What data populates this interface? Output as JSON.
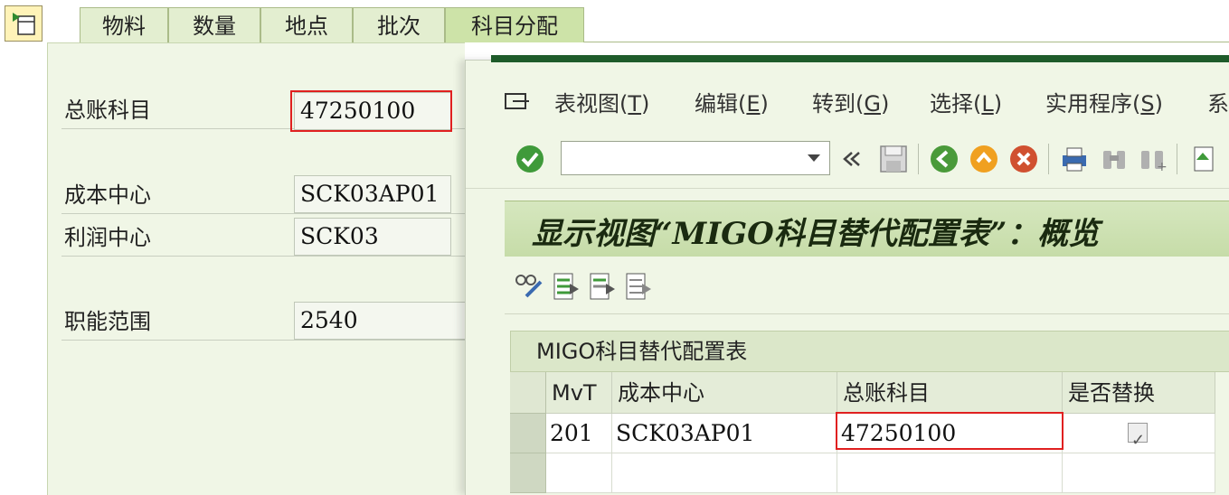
{
  "tabs": [
    {
      "label": "物料"
    },
    {
      "label": "数量"
    },
    {
      "label": "地点"
    },
    {
      "label": "批次"
    },
    {
      "label": "科目分配"
    }
  ],
  "form": {
    "gl_account_label": "总账科目",
    "gl_account_value": "47250100",
    "cost_center_label": "成本中心",
    "cost_center_value": "SCK03AP01",
    "profit_center_label": "利润中心",
    "profit_center_value": "SCK03",
    "functional_area_label": "职能范围",
    "functional_area_value": "2540"
  },
  "dialog": {
    "menu": [
      {
        "label": "表视图(",
        "key": "T",
        "end": ")"
      },
      {
        "label": "编辑(",
        "key": "E",
        "end": ")"
      },
      {
        "label": "转到(",
        "key": "G",
        "end": ")"
      },
      {
        "label": "选择(",
        "key": "L",
        "end": ")"
      },
      {
        "label": "实用程序(",
        "key": "S",
        "end": ")"
      },
      {
        "label": "系",
        "key": "",
        "end": ""
      }
    ],
    "command_field": "",
    "title": "显示视图“MIGO科目替代配置表”：概览",
    "table_caption": "MIGO科目替代配置表",
    "columns": [
      "MvT",
      "成本中心",
      "总账科目",
      "是否替换"
    ],
    "rows": [
      {
        "mvt": "201",
        "cost_center": "SCK03AP01",
        "gl_account": "47250100",
        "replace": true
      }
    ]
  },
  "colors": {
    "highlight": "#e02020",
    "title_bg": "#cde3a8",
    "panel_bg": "#f0f6e6"
  },
  "icons": [
    "layout-icon",
    "enter-check-icon",
    "back-double-icon",
    "save-icon",
    "back-icon",
    "exit-icon",
    "cancel-icon",
    "print-icon",
    "find-icon",
    "find-next-icon",
    "first-page-icon",
    "display-change-icon",
    "select-all-icon",
    "deselect-icon",
    "details-icon"
  ]
}
